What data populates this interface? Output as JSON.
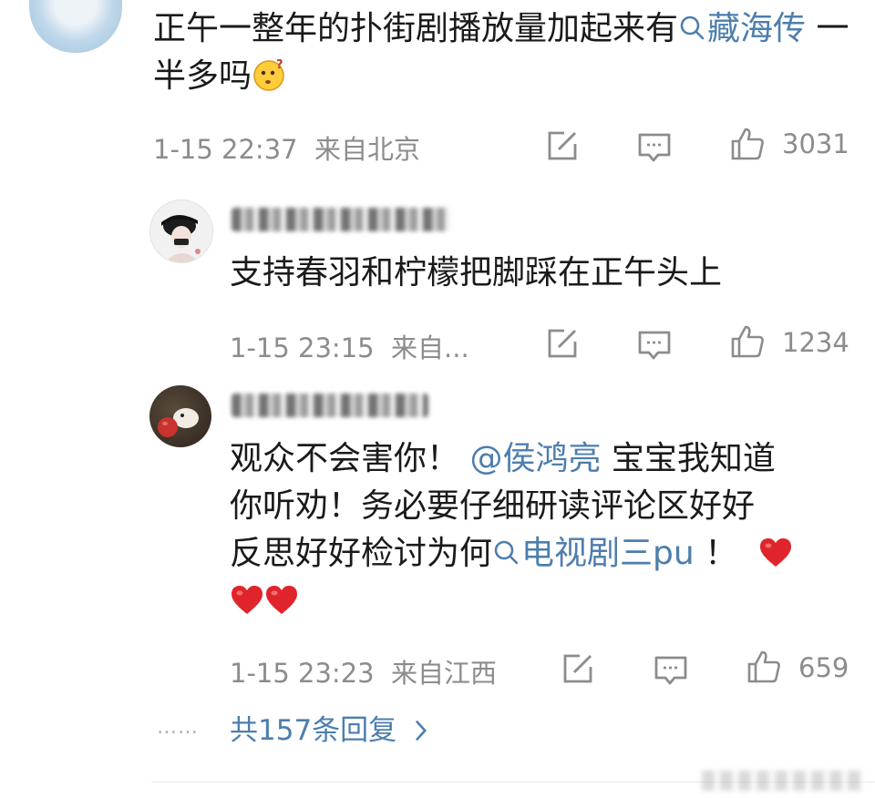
{
  "comments": [
    {
      "text_before": "正午一整年的扑街剧播放量加起来有",
      "topic": "藏海传",
      "text_after": " 一半多吗",
      "emoji": "thinking-face-emoji",
      "time": "1-15 22:37",
      "location": "来自北京",
      "likes": "3031"
    },
    {
      "text": "支持春羽和柠檬把脚踩在正午头上",
      "time": "1-15 23:15",
      "location": "来自...",
      "likes": "1234"
    },
    {
      "text_before": "观众不会害你！",
      "mention": "@侯鸿亮",
      "text_mid1": " 宝宝我知道",
      "text_line2": "你听劝！务必要仔细研读评论区好好",
      "text_line3a": "反思好好检讨为何",
      "topic": "电视剧三pu",
      "text_line3b": "！",
      "time": "1-15 23:23",
      "location": "来自江西",
      "likes": "659"
    }
  ],
  "footer": {
    "dots": "……",
    "more_replies": "共157条回复"
  },
  "colors": {
    "link": "#4d7eae",
    "meta": "#8c8c8c",
    "heart": "#e0242b"
  },
  "icons": [
    "repost-icon",
    "comment-icon",
    "like-icon",
    "search-icon",
    "chevron-right-icon"
  ]
}
